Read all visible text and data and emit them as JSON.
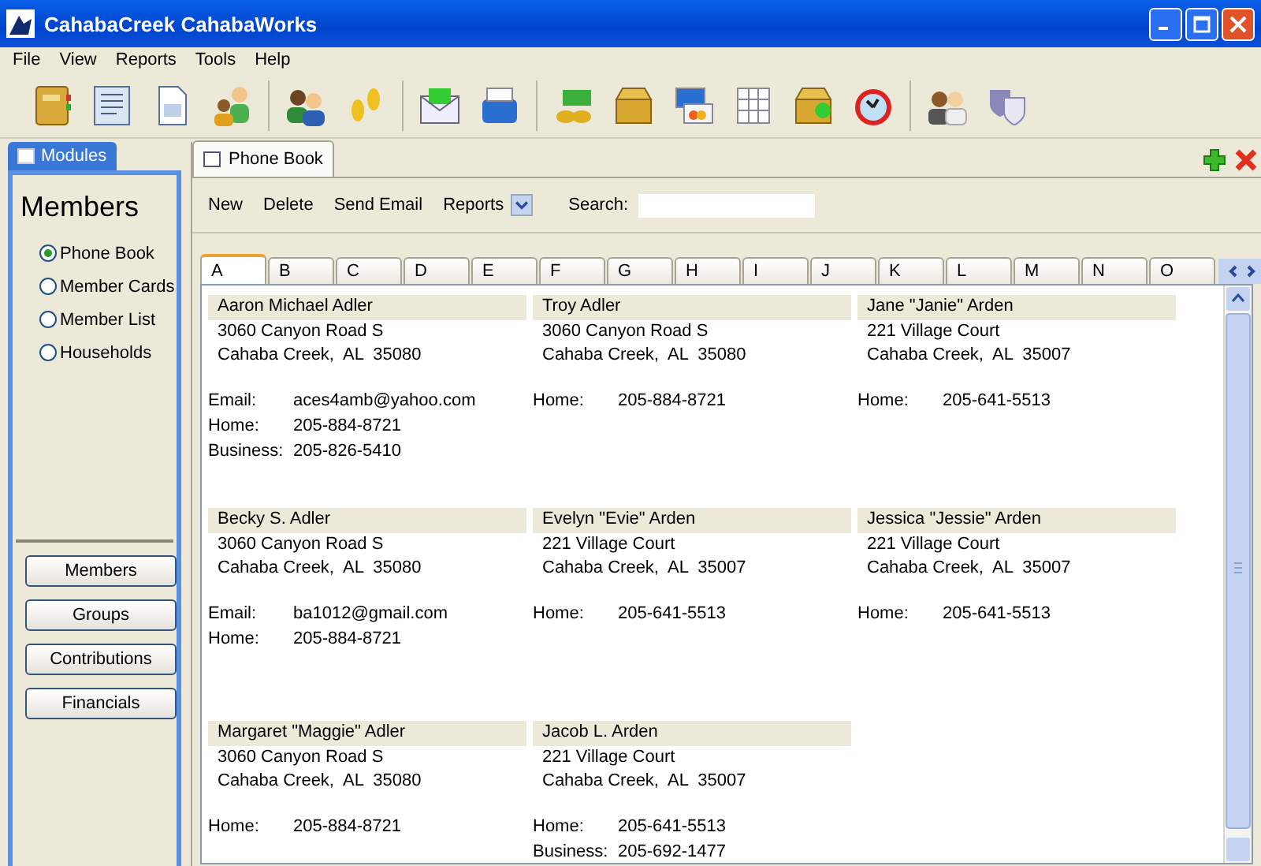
{
  "window": {
    "title": "CahabaCreek CahabaWorks"
  },
  "menu": [
    "File",
    "View",
    "Reports",
    "Tools",
    "Help"
  ],
  "sidebar": {
    "tab": {
      "label": "Modules",
      "selected": true
    },
    "heading": "Members",
    "views": [
      {
        "label": "Phone Book",
        "selected": true
      },
      {
        "label": "Member Cards",
        "selected": false
      },
      {
        "label": "Member List",
        "selected": false
      },
      {
        "label": "Households",
        "selected": false
      }
    ],
    "buttons": [
      "Members",
      "Groups",
      "Contributions",
      "Financials"
    ]
  },
  "document_tab": {
    "label": "Phone Book"
  },
  "actions": [
    {
      "label": "New",
      "kind": "button"
    },
    {
      "label": "Delete",
      "kind": "button"
    },
    {
      "label": "Send Email",
      "kind": "button"
    },
    {
      "label": "Reports",
      "kind": "dropdown"
    }
  ],
  "search": {
    "label": "Search:"
  },
  "letter_tabs": [
    {
      "label": "A",
      "selected": true
    },
    {
      "label": "B",
      "selected": false
    },
    {
      "label": "C",
      "selected": false
    },
    {
      "label": "D",
      "selected": false
    },
    {
      "label": "E",
      "selected": false
    },
    {
      "label": "F",
      "selected": false
    },
    {
      "label": "G",
      "selected": false
    },
    {
      "label": "H",
      "selected": false
    },
    {
      "label": "I",
      "selected": false
    },
    {
      "label": "J",
      "selected": false
    },
    {
      "label": "K",
      "selected": false
    },
    {
      "label": "L",
      "selected": false
    },
    {
      "label": "M",
      "selected": false
    },
    {
      "label": "N",
      "selected": false
    },
    {
      "label": "O",
      "selected": false
    }
  ],
  "contacts": [
    {
      "name": "Aaron Michael Adler",
      "address": [
        "3060 Canyon Road S",
        "Cahaba Creek,  AL  35080"
      ],
      "fields": [
        {
          "label": "Email:",
          "value": "aces4amb@yahoo.com"
        },
        {
          "label": "Home:",
          "value": "205-884-8721"
        },
        {
          "label": "Business:",
          "value": "205-826-5410"
        }
      ]
    },
    {
      "name": "Troy Adler",
      "address": [
        "3060 Canyon Road S",
        "Cahaba Creek,  AL  35080"
      ],
      "fields": [
        {
          "label": "Home:",
          "value": "205-884-8721"
        }
      ]
    },
    {
      "name": "Jane \"Janie\" Arden",
      "address": [
        "221 Village Court",
        "Cahaba Creek,  AL  35007"
      ],
      "fields": [
        {
          "label": "Home:",
          "value": "205-641-5513"
        }
      ]
    },
    {
      "name": "Becky S. Adler",
      "address": [
        "3060 Canyon Road S",
        "Cahaba Creek,  AL  35080"
      ],
      "fields": [
        {
          "label": "Email:",
          "value": "ba1012@gmail.com"
        },
        {
          "label": "Home:",
          "value": "205-884-8721"
        }
      ]
    },
    {
      "name": "Evelyn \"Evie\" Arden",
      "address": [
        "221 Village Court",
        "Cahaba Creek,  AL  35007"
      ],
      "fields": [
        {
          "label": "Home:",
          "value": "205-641-5513"
        }
      ]
    },
    {
      "name": "Jessica \"Jessie\" Arden",
      "address": [
        "221 Village Court",
        "Cahaba Creek,  AL  35007"
      ],
      "fields": [
        {
          "label": "Home:",
          "value": "205-641-5513"
        }
      ]
    },
    {
      "name": "Margaret \"Maggie\" Adler",
      "address": [
        "3060 Canyon Road S",
        "Cahaba Creek,  AL  35080"
      ],
      "fields": [
        {
          "label": "Home:",
          "value": "205-884-8721"
        }
      ]
    },
    {
      "name": "Jacob L. Arden",
      "address": [
        "221 Village Court",
        "Cahaba Creek,  AL  35007"
      ],
      "fields": [
        {
          "label": "Home:",
          "value": "205-641-5513"
        },
        {
          "label": "Business:",
          "value": "205-692-1477"
        }
      ]
    }
  ]
}
